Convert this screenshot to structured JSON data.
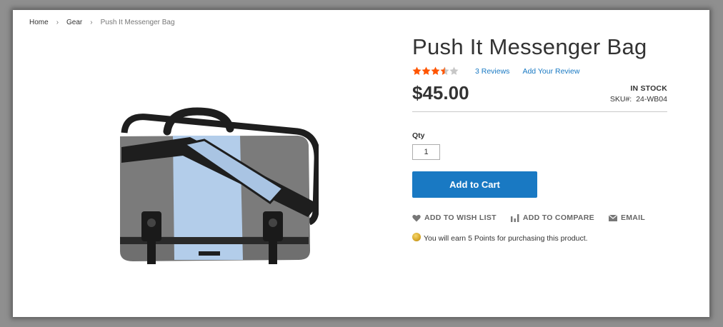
{
  "breadcrumb": {
    "items": [
      "Home",
      "Gear"
    ],
    "current": "Push It Messenger Bag",
    "separator": ">"
  },
  "product": {
    "title": "Push It Messenger Bag",
    "rating": {
      "value": 3.5,
      "max": 5,
      "color_filled": "#ff5501",
      "color_empty": "#c7c7c7"
    },
    "reviews_link": "3 Reviews",
    "add_review_link": "Add Your Review",
    "price": "$45.00",
    "stock": "IN STOCK",
    "sku_label": "SKU#:",
    "sku_value": "24-WB04",
    "qty_label": "Qty",
    "qty_value": "1",
    "add_to_cart": "Add to Cart",
    "actions": {
      "wishlist": "ADD TO WISH LIST",
      "compare": "ADD TO COMPARE",
      "email": "EMAIL"
    },
    "points_text": "You will earn 5 Points for purchasing this product."
  },
  "colors": {
    "primary": "#1979c3",
    "bag_gray": "#707070",
    "bag_blue": "#b3cdea",
    "strap": "#1e1e1e"
  }
}
